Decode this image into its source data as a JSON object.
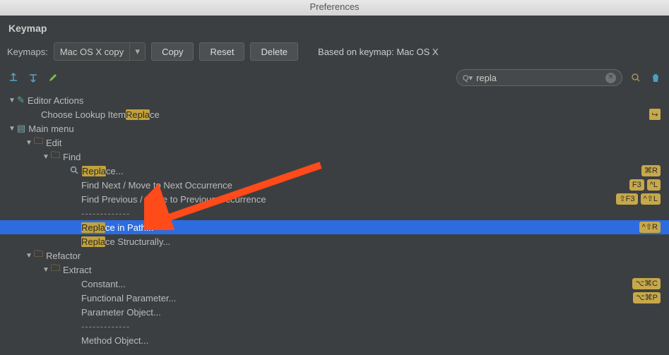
{
  "window": {
    "title": "Preferences"
  },
  "panel": {
    "title": "Keymap"
  },
  "toolbar": {
    "keymaps_label": "Keymaps:",
    "keymap_selected": "Mac OS X copy",
    "copy": "Copy",
    "reset": "Reset",
    "delete": "Delete",
    "based_on": "Based on keymap: Mac OS X"
  },
  "search": {
    "prefix": "Q▾",
    "value": "repla"
  },
  "tree": {
    "editor_actions": "Editor Actions",
    "choose_lookup_pre": "Choose Lookup Item ",
    "choose_lookup_hl": "Repla",
    "choose_lookup_post": "ce",
    "main_menu": "Main menu",
    "edit": "Edit",
    "find": "Find",
    "replace_hl": "Repla",
    "replace_post": "ce...",
    "find_next": "Find Next / Move to Next Occurrence",
    "find_prev": "Find Previous / Move to Previous Occurrence",
    "sep": "-------------",
    "rip_hl": "Repla",
    "rip_post": "ce in Path...",
    "rs_hl": "Repla",
    "rs_post": "ce Structurally...",
    "refactor": "Refactor",
    "extract": "Extract",
    "constant": "Constant...",
    "func_param": "Functional Parameter...",
    "param_obj": "Parameter Object...",
    "method_obj": "Method Object..."
  },
  "shortcuts": {
    "replace": "⌘R",
    "findnext_a": "F3",
    "findnext_b": "^L",
    "findprev_a": "⇧F3",
    "findprev_b": "^⇧L",
    "rip": "^⇧R",
    "constant": "⌥⌘C",
    "funcparam": "⌥⌘P"
  }
}
